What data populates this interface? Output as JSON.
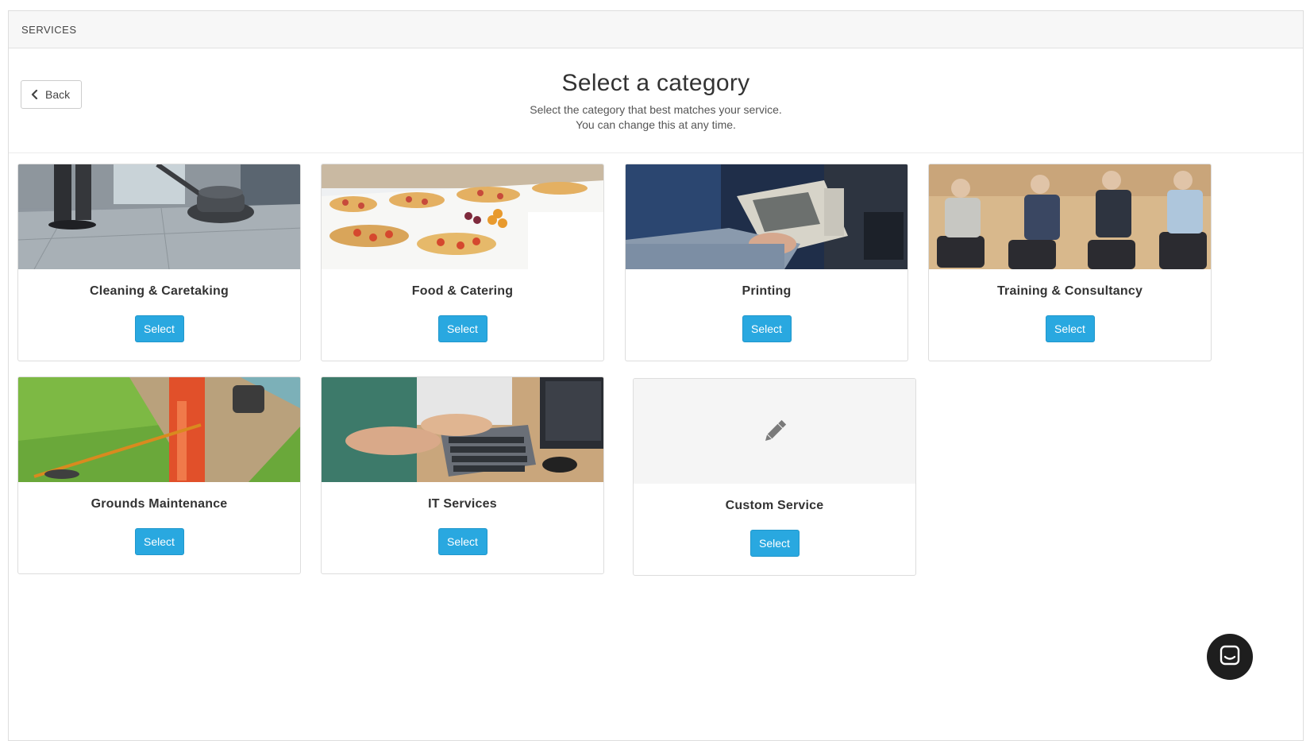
{
  "panel": {
    "heading": "SERVICES"
  },
  "header": {
    "back_label": "Back",
    "title": "Select a category",
    "subtitle_line1": "Select the category that best matches your service.",
    "subtitle_line2": "You can change this at any time."
  },
  "categories": [
    {
      "title": "Cleaning & Caretaking",
      "button": "Select",
      "image": "floor-cleaning-photo"
    },
    {
      "title": "Food & Catering",
      "button": "Select",
      "image": "catering-buffet-photo"
    },
    {
      "title": "Printing",
      "button": "Select",
      "image": "printer-photo"
    },
    {
      "title": "Training & Consultancy",
      "button": "Select",
      "image": "meeting-photo"
    },
    {
      "title": "Grounds Maintenance",
      "button": "Select",
      "image": "grass-trimming-photo"
    },
    {
      "title": "IT Services",
      "button": "Select",
      "image": "keyboard-typing-photo"
    },
    {
      "title": "Custom Service",
      "button": "Select",
      "icon": "pencil-icon"
    }
  ],
  "colors": {
    "accent": "#29a8e0",
    "panel_heading_bg": "#f7f7f7",
    "chat_launcher": "#1e1e1e"
  },
  "icons": {
    "back": "chevron-left-icon",
    "chat": "chat-icon"
  }
}
